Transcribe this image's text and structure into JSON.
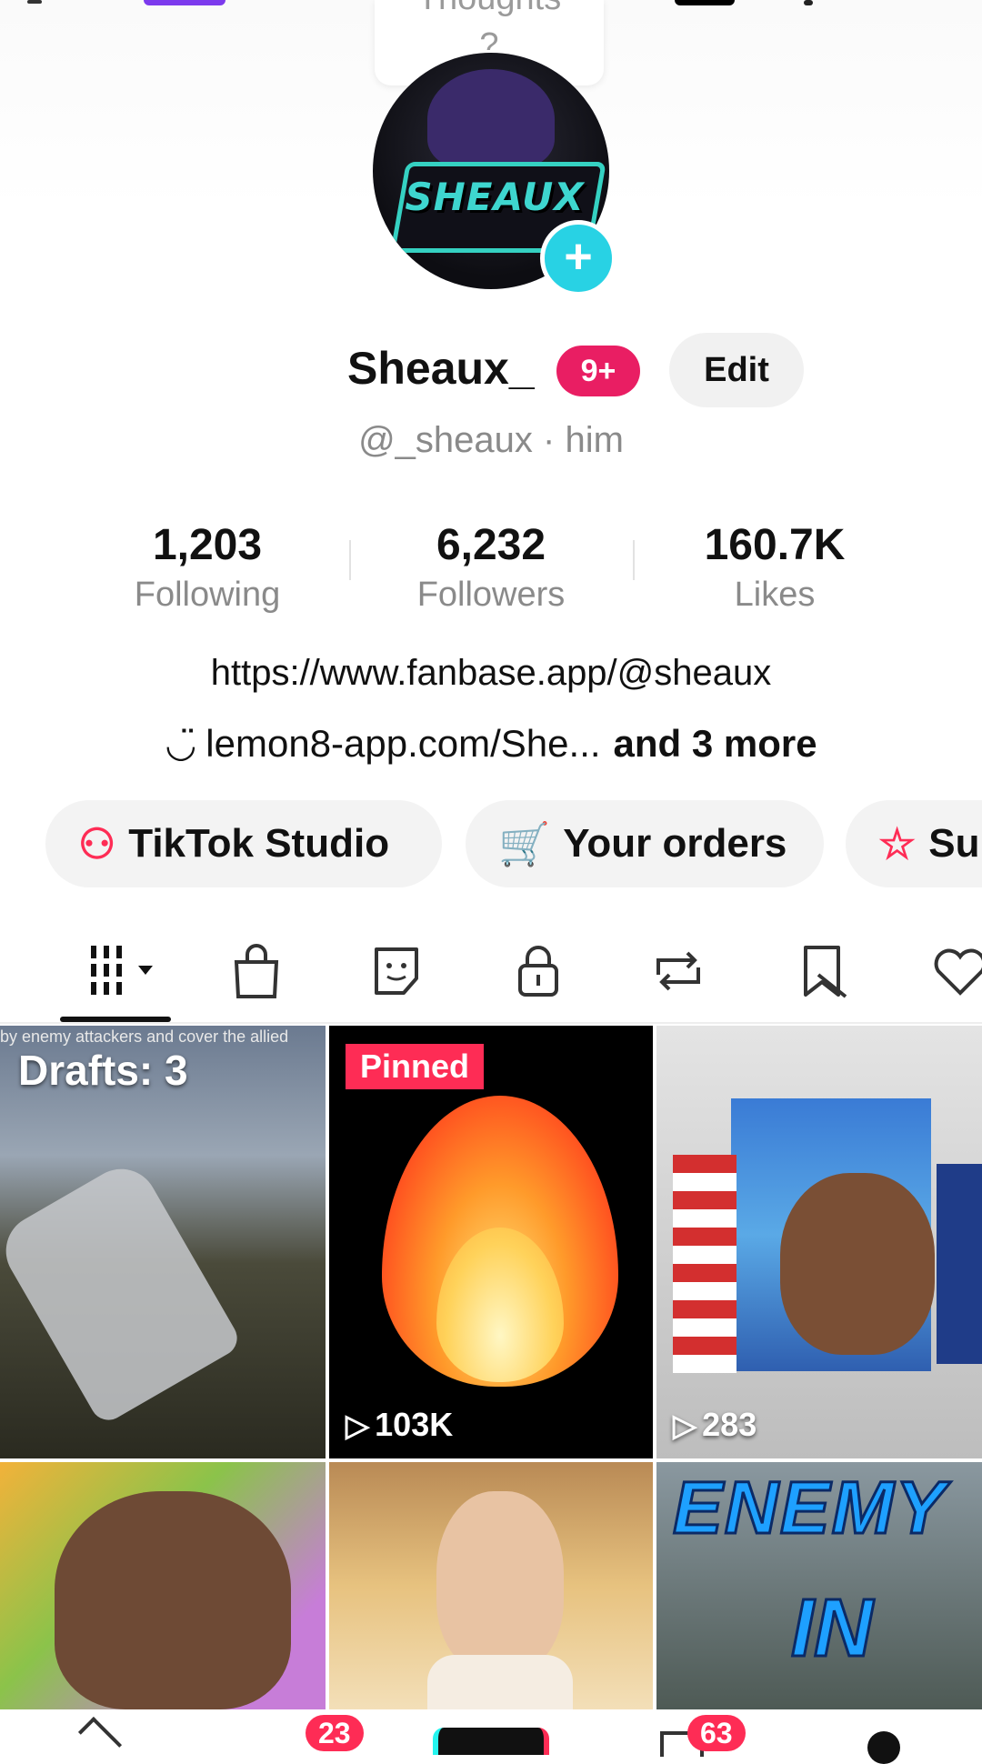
{
  "top": {
    "thought_line1": "Thoughts",
    "thought_line2": "?"
  },
  "profile": {
    "avatar_logo_text": "SHEAUX",
    "display_name": "Sheaux_",
    "notification_badge": "9+",
    "edit_label": "Edit",
    "handle": "@_sheaux · him"
  },
  "stats": [
    {
      "value": "1,203",
      "label": "Following"
    },
    {
      "value": "6,232",
      "label": "Followers"
    },
    {
      "value": "160.7K",
      "label": "Likes"
    }
  ],
  "bio": {
    "link": "https://www.fanbase.app/@sheaux",
    "second_link": "lemon8-app.com/She...",
    "more": "and 3 more"
  },
  "chips": [
    {
      "label": "TikTok Studio",
      "icon": "person-star-icon"
    },
    {
      "label": "Your orders",
      "icon": "cart-icon"
    },
    {
      "label": "Su",
      "icon": "sparkle-icon"
    }
  ],
  "tabs": [
    {
      "name": "videos-grid-icon"
    },
    {
      "name": "shop-bag-icon"
    },
    {
      "name": "stickers-icon"
    },
    {
      "name": "lock-icon"
    },
    {
      "name": "repost-icon"
    },
    {
      "name": "favorites-hidden-icon"
    },
    {
      "name": "liked-hidden-icon"
    }
  ],
  "grid": {
    "drafts_label": "Drafts: 3",
    "drafts_caption": "by enemy attackers and cover the allied",
    "pinned_label": "Pinned",
    "pinned_views": "103K",
    "video3_views": "283",
    "video6_text_line1": "ENEMY",
    "video6_text_line2": "IN"
  },
  "nav": {
    "friends_badge": "23",
    "inbox_badge": "63"
  },
  "colors": {
    "accent": "#fe2c55",
    "teal": "#25f4ee"
  }
}
